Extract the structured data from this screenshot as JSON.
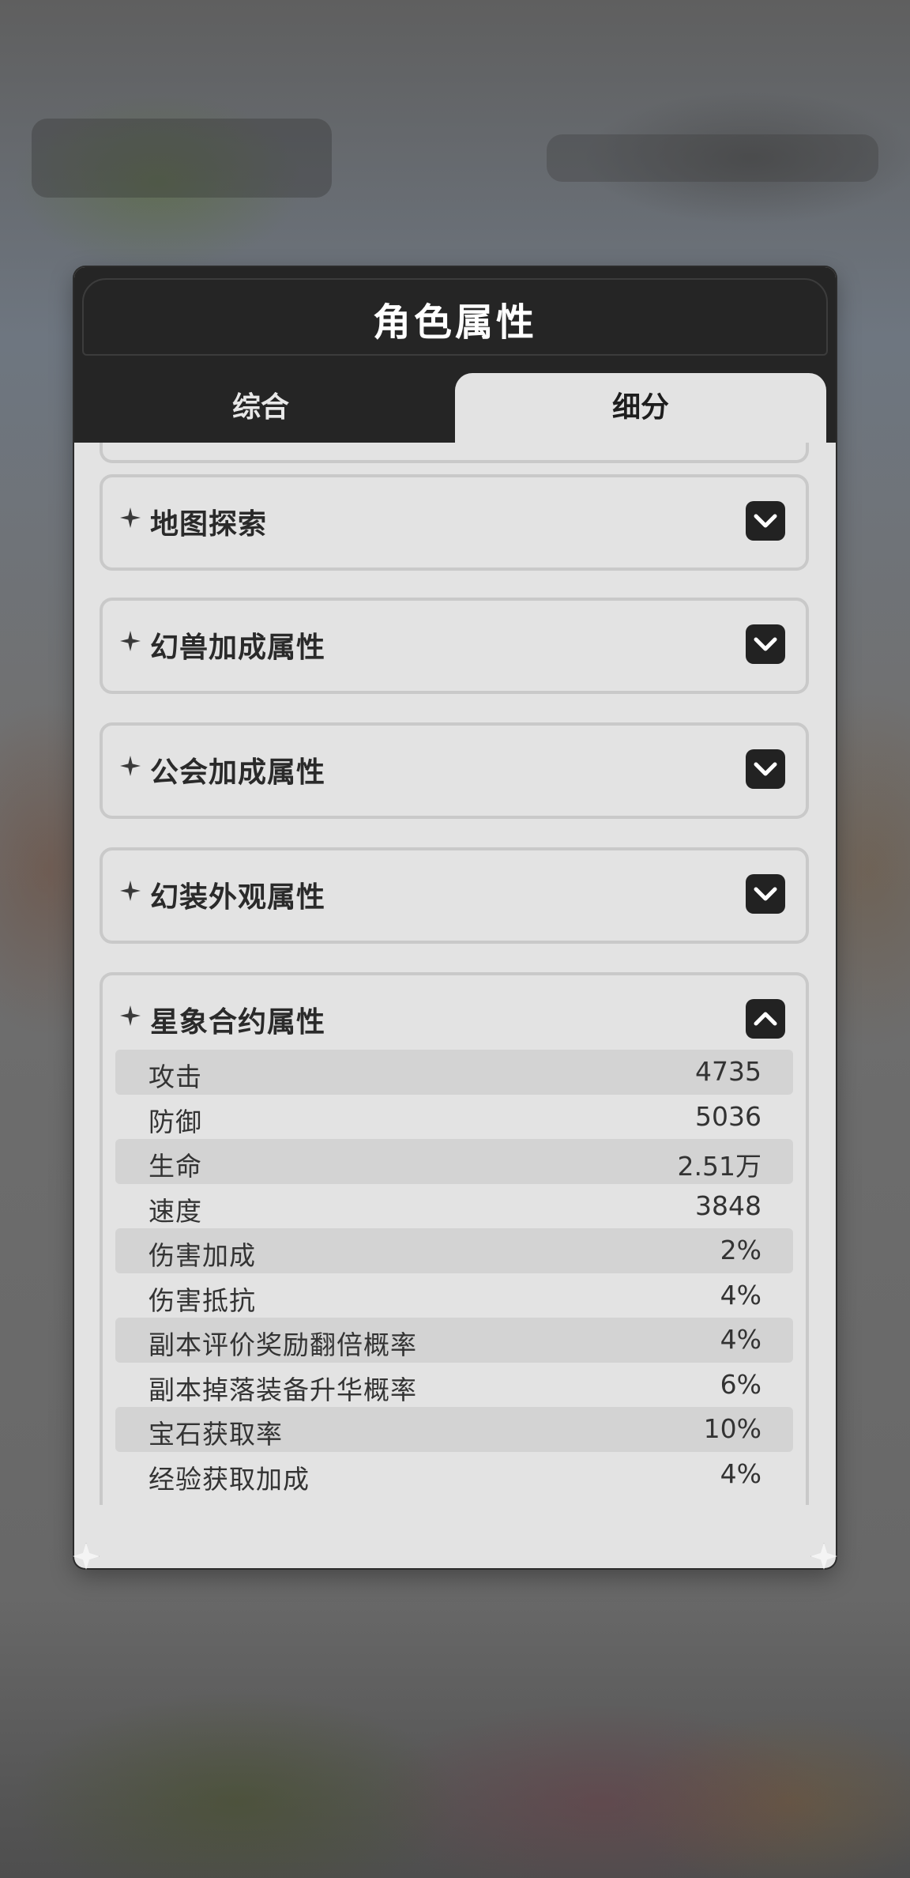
{
  "dialog": {
    "title": "角色属性"
  },
  "tabs": [
    {
      "label": "综合",
      "active": false
    },
    {
      "label": "细分",
      "active": true
    }
  ],
  "sections": [
    {
      "title": "地图探索",
      "expanded": false
    },
    {
      "title": "幻兽加成属性",
      "expanded": false
    },
    {
      "title": "公会加成属性",
      "expanded": false
    },
    {
      "title": "幻装外观属性",
      "expanded": false
    },
    {
      "title": "星象合约属性",
      "expanded": true,
      "stats": [
        {
          "label": "攻击",
          "value": "4735"
        },
        {
          "label": "防御",
          "value": "5036"
        },
        {
          "label": "生命",
          "value": "2.51万"
        },
        {
          "label": "速度",
          "value": "3848"
        },
        {
          "label": "伤害加成",
          "value": "2%"
        },
        {
          "label": "伤害抵抗",
          "value": "4%"
        },
        {
          "label": "副本评价奖励翻倍概率",
          "value": "4%"
        },
        {
          "label": "副本掉落装备升华概率",
          "value": "6%"
        },
        {
          "label": "宝石获取率",
          "value": "10%"
        },
        {
          "label": "经验获取加成",
          "value": "4%"
        }
      ]
    }
  ],
  "colors": {
    "header_bg": "#252525",
    "panel_bg": "#e3e3e3",
    "row_shade": "#d3d3d3",
    "card_border": "#c9c9c9"
  }
}
